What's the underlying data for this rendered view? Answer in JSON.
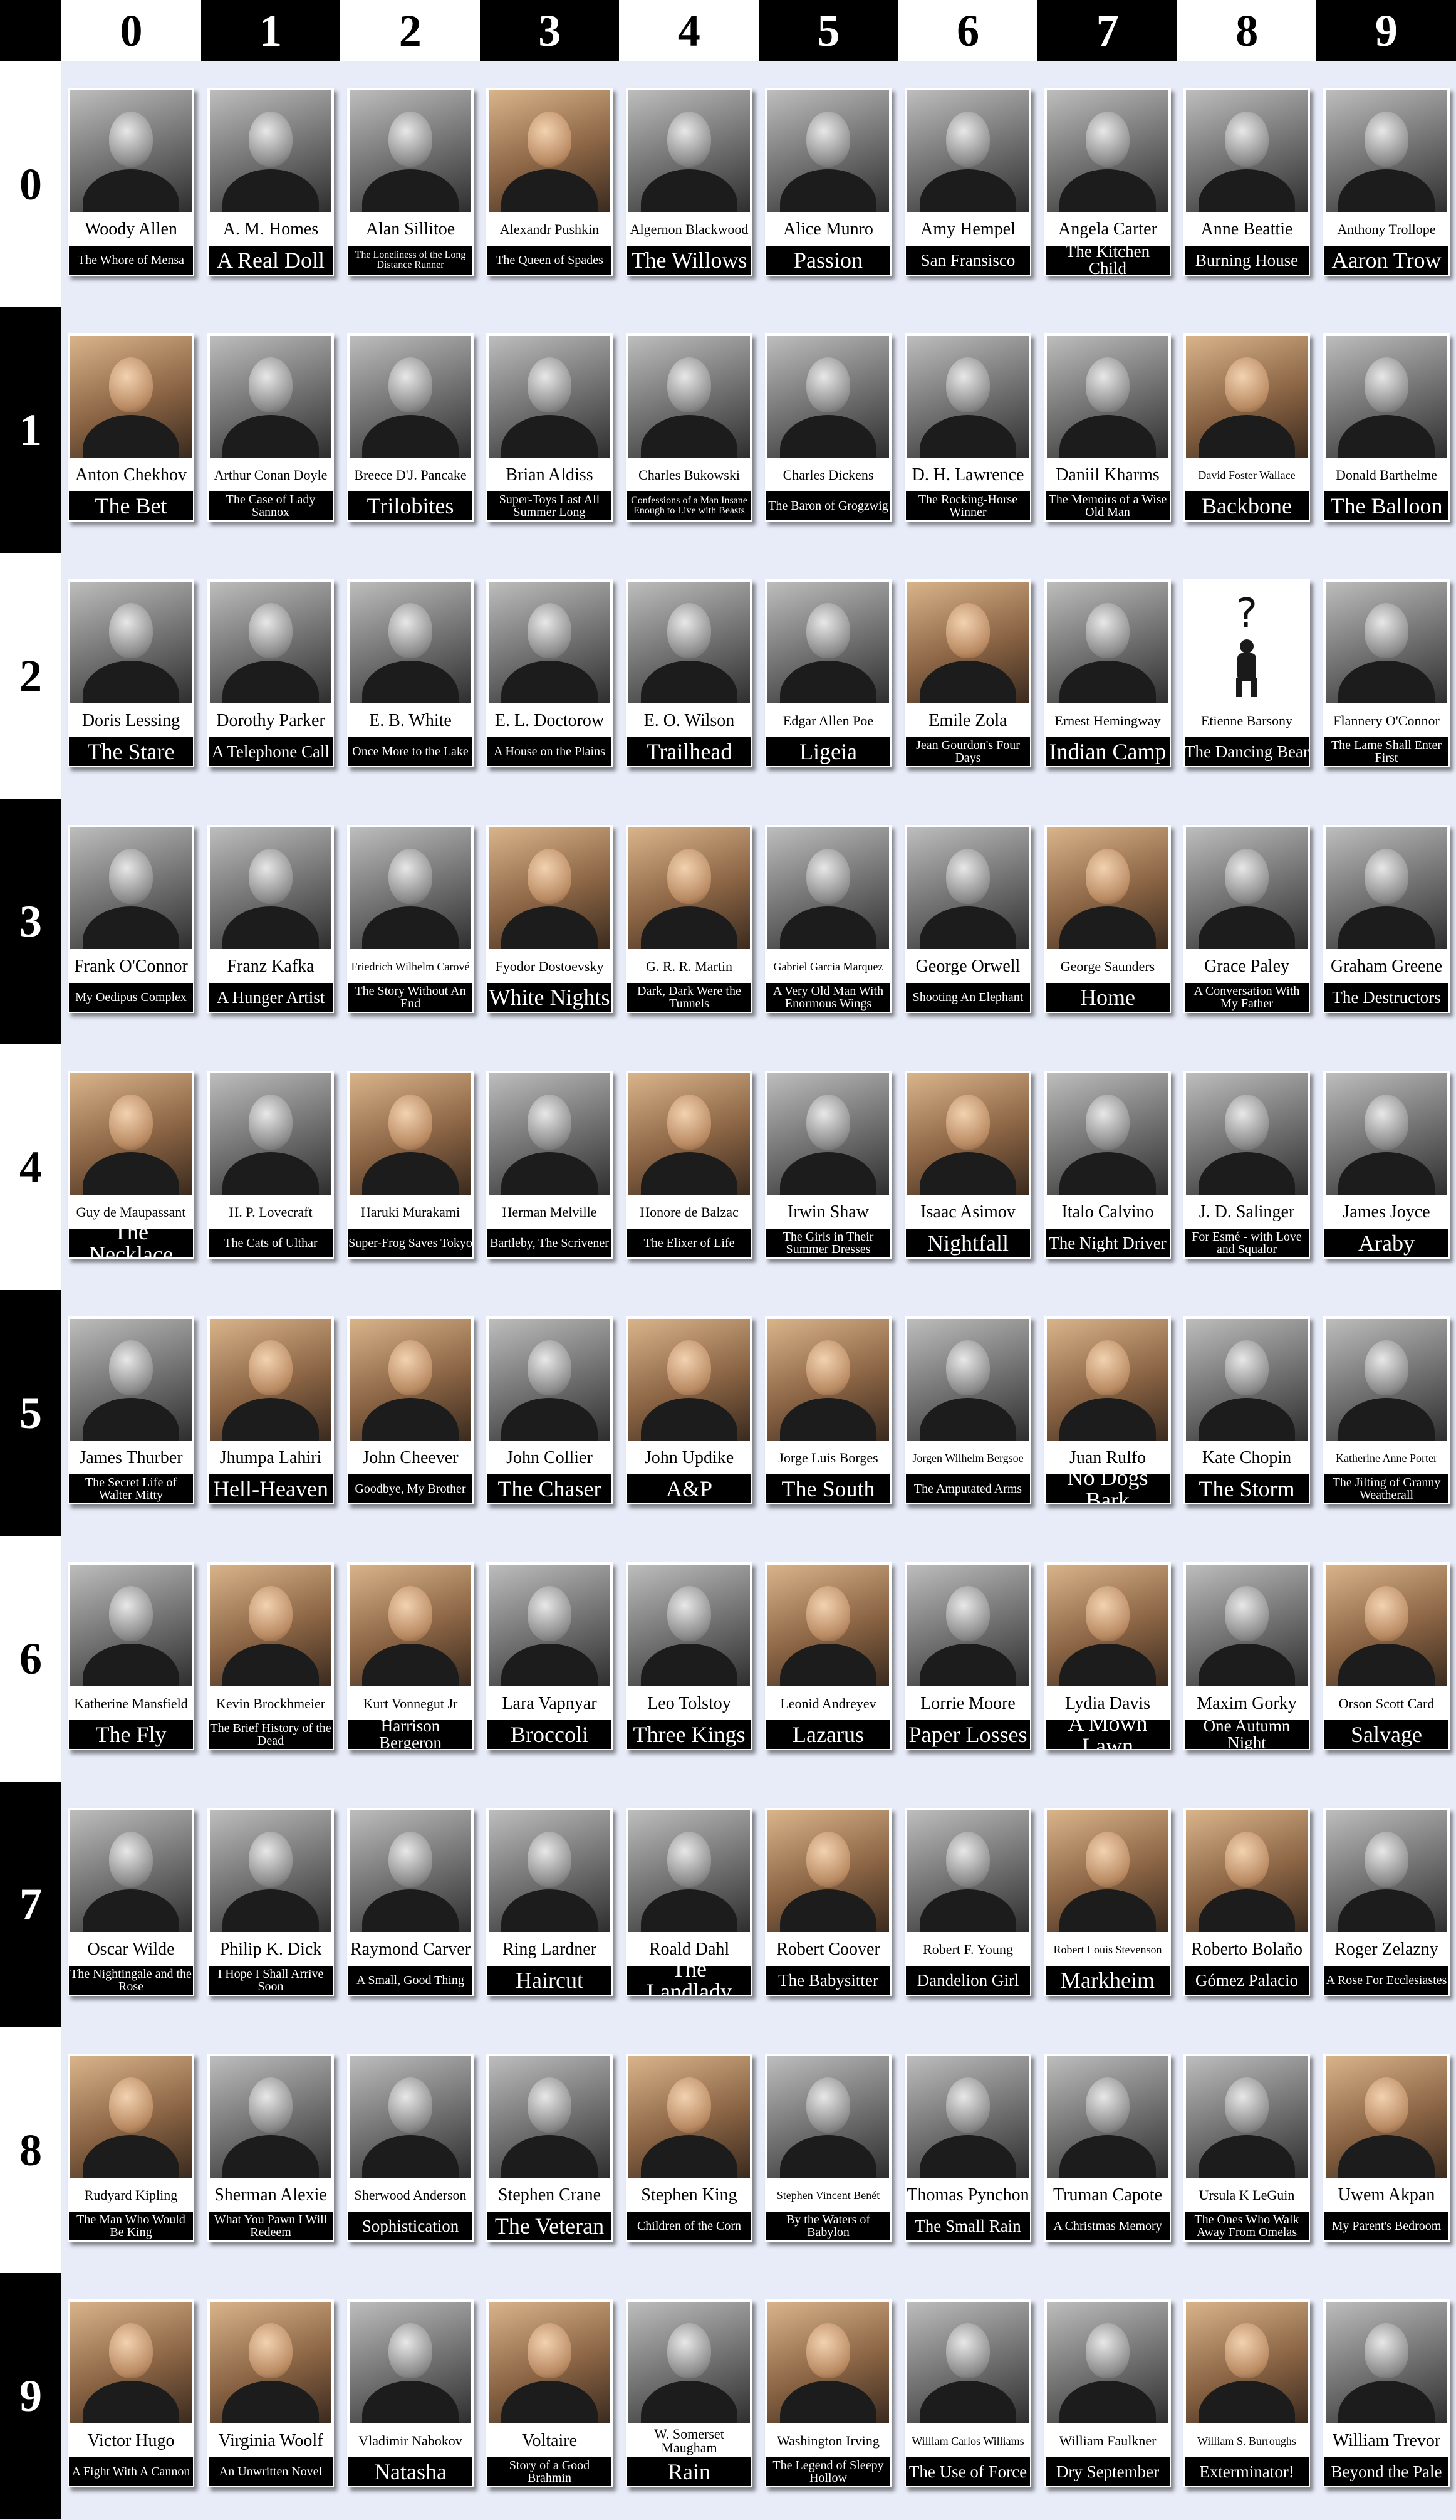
{
  "column_labels": [
    "0",
    "1",
    "2",
    "3",
    "4",
    "5",
    "6",
    "7",
    "8",
    "9"
  ],
  "row_labels": [
    "0",
    "1",
    "2",
    "3",
    "4",
    "5",
    "6",
    "7",
    "8",
    "9"
  ],
  "rows": [
    {
      "cards": [
        {
          "author": "Woody Allen",
          "story": "The Whore of Mensa"
        },
        {
          "author": "A. M. Homes",
          "story": "A Real Doll"
        },
        {
          "author": "Alan Sillitoe",
          "story": "The Loneliness of the Long Distance Runner"
        },
        {
          "author": "Alexandr Pushkin",
          "story": "The Queen of Spades",
          "color": true
        },
        {
          "author": "Algernon Blackwood",
          "story": "The Willows"
        },
        {
          "author": "Alice Munro",
          "story": "Passion"
        },
        {
          "author": "Amy Hempel",
          "story": "San Fransisco"
        },
        {
          "author": "Angela Carter",
          "story": "The Kitchen Child"
        },
        {
          "author": "Anne Beattie",
          "story": "Burning House"
        },
        {
          "author": "Anthony Trollope",
          "story": "Aaron Trow"
        }
      ]
    },
    {
      "cards": [
        {
          "author": "Anton Chekhov",
          "story": "The Bet",
          "color": true
        },
        {
          "author": "Arthur Conan Doyle",
          "story": "The Case of Lady Sannox"
        },
        {
          "author": "Breece D'J. Pancake",
          "story": "Trilobites"
        },
        {
          "author": "Brian Aldiss",
          "story": "Super-Toys Last All Summer Long"
        },
        {
          "author": "Charles Bukowski",
          "story": "Confessions of a Man Insane Enough to Live with Beasts"
        },
        {
          "author": "Charles Dickens",
          "story": "The Baron of Grogzwig"
        },
        {
          "author": "D. H. Lawrence",
          "story": "The Rocking-Horse Winner"
        },
        {
          "author": "Daniil Kharms",
          "story": "The Memoirs of a Wise Old Man"
        },
        {
          "author": "David Foster Wallace",
          "story": "Backbone",
          "color": true
        },
        {
          "author": "Donald Barthelme",
          "story": "The Balloon"
        }
      ]
    },
    {
      "cards": [
        {
          "author": "Doris Lessing",
          "story": "The Stare"
        },
        {
          "author": "Dorothy Parker",
          "story": "A Telephone Call"
        },
        {
          "author": "E. B. White",
          "story": "Once More to the Lake"
        },
        {
          "author": "E. L. Doctorow",
          "story": "A House on the Plains"
        },
        {
          "author": "E. O. Wilson",
          "story": "Trailhead"
        },
        {
          "author": "Edgar Allen Poe",
          "story": "Ligeia"
        },
        {
          "author": "Emile Zola",
          "story": "Jean Gourdon's Four Days",
          "color": true
        },
        {
          "author": "Ernest Hemingway",
          "story": "Indian Camp"
        },
        {
          "author": "Etienne Barsony",
          "story": "The Dancing Bear",
          "unknown": true
        },
        {
          "author": "Flannery O'Connor",
          "story": "The Lame Shall Enter First"
        }
      ]
    },
    {
      "cards": [
        {
          "author": "Frank O'Connor",
          "story": "My Oedipus Complex"
        },
        {
          "author": "Franz Kafka",
          "story": "A Hunger Artist"
        },
        {
          "author": "Friedrich Wilhelm Carové",
          "story": "The Story Without An End"
        },
        {
          "author": "Fyodor Dostoevsky",
          "story": "White Nights",
          "color": true
        },
        {
          "author": "G. R. R. Martin",
          "story": "Dark, Dark Were the Tunnels",
          "color": true
        },
        {
          "author": "Gabriel Garcia Marquez",
          "story": "A Very Old Man With Enormous Wings"
        },
        {
          "author": "George Orwell",
          "story": "Shooting An Elephant"
        },
        {
          "author": "George Saunders",
          "story": "Home",
          "color": true
        },
        {
          "author": "Grace Paley",
          "story": "A Conversation With My Father"
        },
        {
          "author": "Graham Greene",
          "story": "The Destructors"
        }
      ]
    },
    {
      "cards": [
        {
          "author": "Guy de Maupassant",
          "story": "The Necklace",
          "color": true
        },
        {
          "author": "H. P. Lovecraft",
          "story": "The Cats of Ulthar"
        },
        {
          "author": "Haruki Murakami",
          "story": "Super-Frog Saves Tokyo",
          "color": true
        },
        {
          "author": "Herman Melville",
          "story": "Bartleby, The Scrivener"
        },
        {
          "author": "Honore de Balzac",
          "story": "The Elixer of Life",
          "color": true
        },
        {
          "author": "Irwin Shaw",
          "story": "The Girls in Their Summer Dresses"
        },
        {
          "author": "Isaac Asimov",
          "story": "Nightfall",
          "color": true
        },
        {
          "author": "Italo Calvino",
          "story": "The Night Driver"
        },
        {
          "author": "J. D. Salinger",
          "story": "For Esmé - with Love and Squalor"
        },
        {
          "author": "James Joyce",
          "story": "Araby"
        }
      ]
    },
    {
      "cards": [
        {
          "author": "James Thurber",
          "story": "The Secret Life of Walter Mitty"
        },
        {
          "author": "Jhumpa Lahiri",
          "story": "Hell-Heaven",
          "color": true
        },
        {
          "author": "John Cheever",
          "story": "Goodbye, My Brother",
          "color": true
        },
        {
          "author": "John Collier",
          "story": "The Chaser"
        },
        {
          "author": "John Updike",
          "story": "A&P",
          "color": true
        },
        {
          "author": "Jorge Luis Borges",
          "story": "The South",
          "color": true
        },
        {
          "author": "Jorgen Wilhelm Bergsoe",
          "story": "The Amputated Arms"
        },
        {
          "author": "Juan Rulfo",
          "story": "No Dogs Bark",
          "color": true
        },
        {
          "author": "Kate Chopin",
          "story": "The Storm"
        },
        {
          "author": "Katherine Anne Porter",
          "story": "The Jilting of Granny Weatherall"
        }
      ]
    },
    {
      "cards": [
        {
          "author": "Katherine Mansfield",
          "story": "The Fly"
        },
        {
          "author": "Kevin Brockhmeier",
          "story": "The Brief History of the Dead",
          "color": true
        },
        {
          "author": "Kurt Vonnegut Jr",
          "story": "Harrison Bergeron",
          "color": true
        },
        {
          "author": "Lara Vapnyar",
          "story": "Broccoli"
        },
        {
          "author": "Leo Tolstoy",
          "story": "Three Kings"
        },
        {
          "author": "Leonid Andreyev",
          "story": "Lazarus",
          "color": true
        },
        {
          "author": "Lorrie Moore",
          "story": "Paper Losses"
        },
        {
          "author": "Lydia Davis",
          "story": "A Mown Lawn",
          "color": true
        },
        {
          "author": "Maxim Gorky",
          "story": "One Autumn Night"
        },
        {
          "author": "Orson Scott Card",
          "story": "Salvage",
          "color": true
        }
      ]
    },
    {
      "cards": [
        {
          "author": "Oscar Wilde",
          "story": "The Nightingale and the Rose"
        },
        {
          "author": "Philip K. Dick",
          "story": "I Hope I Shall Arrive Soon"
        },
        {
          "author": "Raymond Carver",
          "story": "A Small, Good Thing"
        },
        {
          "author": "Ring Lardner",
          "story": "Haircut"
        },
        {
          "author": "Roald Dahl",
          "story": "The Landlady"
        },
        {
          "author": "Robert Coover",
          "story": "The Babysitter",
          "color": true
        },
        {
          "author": "Robert F. Young",
          "story": "Dandelion Girl"
        },
        {
          "author": "Robert Louis Stevenson",
          "story": "Markheim",
          "color": true
        },
        {
          "author": "Roberto Bolaño",
          "story": "Gómez Palacio",
          "color": true
        },
        {
          "author": "Roger Zelazny",
          "story": "A Rose For Ecclesiastes"
        }
      ]
    },
    {
      "cards": [
        {
          "author": "Rudyard Kipling",
          "story": "The Man Who Would Be King",
          "color": true
        },
        {
          "author": "Sherman Alexie",
          "story": "What You Pawn I Will Redeem"
        },
        {
          "author": "Sherwood Anderson",
          "story": "Sophistication"
        },
        {
          "author": "Stephen Crane",
          "story": "The Veteran"
        },
        {
          "author": "Stephen King",
          "story": "Children of the Corn",
          "color": true
        },
        {
          "author": "Stephen Vincent Benét",
          "story": "By the Waters of Babylon"
        },
        {
          "author": "Thomas Pynchon",
          "story": "The Small Rain"
        },
        {
          "author": "Truman Capote",
          "story": "A Christmas Memory"
        },
        {
          "author": "Ursula K LeGuin",
          "story": "The Ones Who Walk Away From Omelas"
        },
        {
          "author": "Uwem Akpan",
          "story": "My Parent's Bedroom",
          "color": true
        }
      ]
    },
    {
      "cards": [
        {
          "author": "Victor Hugo",
          "story": "A Fight With A Cannon",
          "color": true
        },
        {
          "author": "Virginia Woolf",
          "story": "An Unwritten Novel",
          "color": true
        },
        {
          "author": "Vladimir Nabokov",
          "story": "Natasha"
        },
        {
          "author": "Voltaire",
          "story": "Story of a Good Brahmin",
          "color": true
        },
        {
          "author": "W. Somerset Maugham",
          "story": "Rain"
        },
        {
          "author": "Washington Irving",
          "story": "The Legend of Sleepy Hollow",
          "color": true
        },
        {
          "author": "William Carlos Williams",
          "story": "The Use of Force"
        },
        {
          "author": "William Faulkner",
          "story": "Dry September"
        },
        {
          "author": "William S. Burroughs",
          "story": "Exterminator!",
          "color": true
        },
        {
          "author": "William Trevor",
          "story": "Beyond the Pale"
        }
      ]
    }
  ],
  "colors": {
    "page_background": "#e8ecf8",
    "header_dark": "#000000",
    "header_light": "#ffffff",
    "title_bar": "#000000"
  }
}
